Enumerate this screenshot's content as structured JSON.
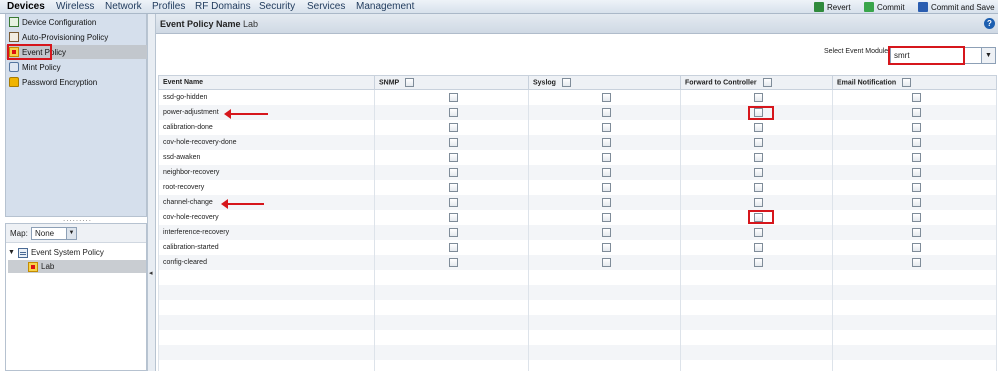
{
  "menubar": {
    "items": [
      "Devices",
      "Wireless",
      "Network",
      "Profiles",
      "RF Domains",
      "Security",
      "Services",
      "Management"
    ],
    "actions": {
      "revert": "Revert",
      "commit": "Commit",
      "commit_save": "Commit and Save"
    }
  },
  "sidebar": {
    "items": [
      "Device Configuration",
      "Auto-Provisioning Policy",
      "Event Policy",
      "Mint Policy",
      "Password Encryption"
    ],
    "selected_index": 2
  },
  "map": {
    "label": "Map:",
    "selected": "None",
    "tree": {
      "root": "Event System Policy",
      "child": "Lab"
    }
  },
  "main": {
    "title": "Event Policy Name",
    "policy_name": "Lab",
    "module_label": "Select Event Module",
    "module_value": "smrt",
    "columns": [
      "Event Name",
      "SNMP",
      "Syslog",
      "Forward to Controller",
      "Email Notification"
    ],
    "rows": [
      "ssd-go-hidden",
      "power-adjustment",
      "calibration-done",
      "cov-hole-recovery-done",
      "ssd-awaken",
      "neighbor-recovery",
      "root-recovery",
      "channel-change",
      "cov-hole-recovery",
      "interference-recovery",
      "calibration-started",
      "config-cleared"
    ],
    "empty_row_count": 7
  },
  "colors": {
    "annotation": "#d6161c",
    "accent": "#1d5fb0"
  }
}
